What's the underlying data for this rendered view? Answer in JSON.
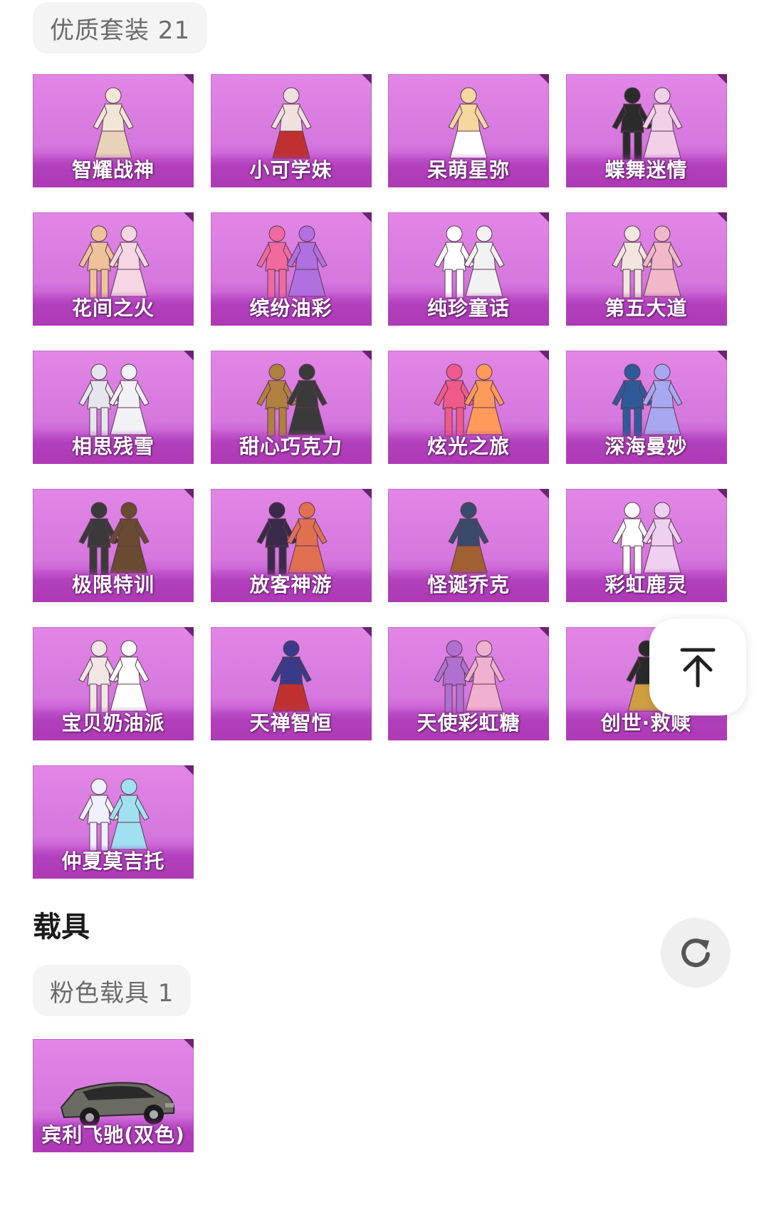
{
  "group1": {
    "label": "优质套装 21",
    "items": [
      {
        "name": "智耀战神",
        "fig": "single",
        "c": "#f2e6d6",
        "c2": "#e8d2b8"
      },
      {
        "name": "小可学妹",
        "fig": "single",
        "c": "#f0e0e0",
        "c2": "#c03030"
      },
      {
        "name": "呆萌星弥",
        "fig": "single",
        "c": "#f6d7a0",
        "c2": "#ffffff"
      },
      {
        "name": "蝶舞迷情",
        "fig": "pair",
        "c": "#2b2b2b",
        "c2": "#f2d0e8"
      },
      {
        "name": "花间之火",
        "fig": "pair",
        "c": "#f0c29c",
        "c2": "#f6d6e2"
      },
      {
        "name": "缤纷油彩",
        "fig": "pair",
        "c": "#f06aa0",
        "c2": "#b070e0"
      },
      {
        "name": "纯珍童话",
        "fig": "pair",
        "c": "#ffffff",
        "c2": "#f2f2f2"
      },
      {
        "name": "第五大道",
        "fig": "pair",
        "c": "#f3e6e0",
        "c2": "#f0b8c8"
      },
      {
        "name": "相思残雪",
        "fig": "pair",
        "c": "#e6e6ef",
        "c2": "#f2f2f6"
      },
      {
        "name": "甜心巧克力",
        "fig": "pair",
        "c": "#b08040",
        "c2": "#3a3a3a"
      },
      {
        "name": "炫光之旅",
        "fig": "pair",
        "c": "#f05a8a",
        "c2": "#ff9a5a"
      },
      {
        "name": "深海曼妙",
        "fig": "pair",
        "c": "#2f5a9a",
        "c2": "#a8a8f0"
      },
      {
        "name": "极限特训",
        "fig": "pair",
        "c": "#3a3a3a",
        "c2": "#6a4a30"
      },
      {
        "name": "放客神游",
        "fig": "pair",
        "c": "#3a2a4a",
        "c2": "#e07050"
      },
      {
        "name": "怪诞乔克",
        "fig": "single",
        "c": "#3a4a6a",
        "c2": "#a06030"
      },
      {
        "name": "彩虹鹿灵",
        "fig": "pair",
        "c": "#ffffff",
        "c2": "#f0d0f0"
      },
      {
        "name": "宝贝奶油派",
        "fig": "pair",
        "c": "#f2e6e6",
        "c2": "#ffffff"
      },
      {
        "name": "天禅智恒",
        "fig": "single",
        "c": "#3a3a8a",
        "c2": "#c03030"
      },
      {
        "name": "天使彩虹糖",
        "fig": "pair",
        "c": "#b070d0",
        "c2": "#f0b0d0"
      },
      {
        "name": "创世·救赎",
        "fig": "single",
        "c": "#2a2a2a",
        "c2": "#d0a040"
      },
      {
        "name": "仲夏莫吉托",
        "fig": "pair",
        "c": "#f0f0ff",
        "c2": "#a0e0f0"
      }
    ]
  },
  "section_vehicle": {
    "title": "载具"
  },
  "group2": {
    "label": "粉色载具 1",
    "items": [
      {
        "name": "宾利飞驰(双色)",
        "fig": "car",
        "c": "#6a6a62",
        "c2": "#9a9a90"
      }
    ]
  },
  "fab": {
    "top_icon": "arrow-up-to-top-icon",
    "refresh_icon": "refresh-icon"
  }
}
